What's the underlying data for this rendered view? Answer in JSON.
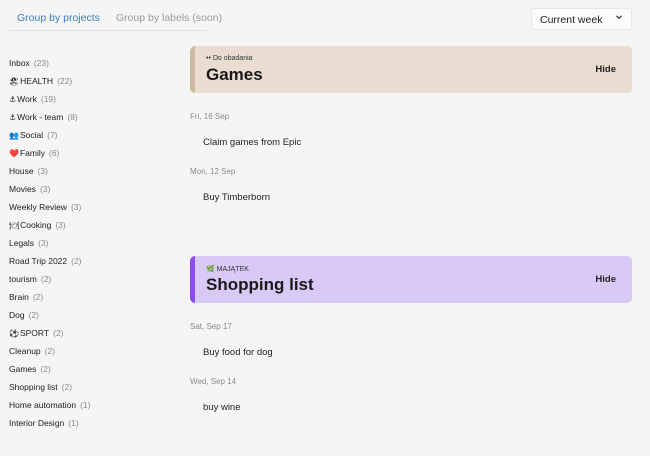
{
  "tabs": [
    {
      "label": "Group by projects",
      "active": true
    },
    {
      "label": "Group by labels (soon)",
      "active": false
    }
  ],
  "period_select": {
    "value": "Current week",
    "icon": "chevron-down-icon"
  },
  "projects": [
    {
      "emoji": "",
      "name": "Inbox",
      "count": "(23)"
    },
    {
      "emoji": "🏖",
      "name": "HEALTH",
      "count": "(22)"
    },
    {
      "emoji": "⚓",
      "name": "Work",
      "count": "(19)"
    },
    {
      "emoji": "⚓",
      "name": "Work - team",
      "count": "(8)"
    },
    {
      "emoji": "👥",
      "name": "Social",
      "count": "(7)"
    },
    {
      "emoji": "❤️",
      "name": "Family",
      "count": "(6)"
    },
    {
      "emoji": "",
      "name": "House",
      "count": "(3)"
    },
    {
      "emoji": "",
      "name": "Movies",
      "count": "(3)"
    },
    {
      "emoji": "",
      "name": "Weekly Review",
      "count": "(3)"
    },
    {
      "emoji": "🍽",
      "name": "Cooking",
      "count": "(3)"
    },
    {
      "emoji": "",
      "name": "Legals",
      "count": "(3)"
    },
    {
      "emoji": "",
      "name": "Road Trip 2022",
      "count": "(2)"
    },
    {
      "emoji": "",
      "name": "tourism",
      "count": "(2)"
    },
    {
      "emoji": "",
      "name": "Brain",
      "count": "(2)"
    },
    {
      "emoji": "",
      "name": "Dog",
      "count": "(2)"
    },
    {
      "emoji": "⚽",
      "name": "SPORT",
      "count": "(2)"
    },
    {
      "emoji": "",
      "name": "Cleanup",
      "count": "(2)"
    },
    {
      "emoji": "",
      "name": "Games",
      "count": "(2)"
    },
    {
      "emoji": "",
      "name": "Shopping list",
      "count": "(2)"
    },
    {
      "emoji": "",
      "name": "Home automation",
      "count": "(1)"
    },
    {
      "emoji": "",
      "name": "Interior Design",
      "count": "(1)"
    }
  ],
  "cards": {
    "games": {
      "subtitle": "•• Do obadania",
      "title": "Games",
      "hide_label": "Hide",
      "bg": "#e9ddd1",
      "border": "#cdb8a0",
      "tasks": [
        {
          "date": "Fri, 16 Sep",
          "text": "Claim games from Epic"
        },
        {
          "date": "Mon, 12 Sep",
          "text": "Buy Timberborn"
        }
      ]
    },
    "shopping": {
      "subtitle": "🌿 MAJĄTEK",
      "title": "Shopping list",
      "hide_label": "Hide",
      "bg": "#d9c9f7",
      "border": "#8a4cf0",
      "tasks": [
        {
          "date": "Sat, Sep 17",
          "text": "Buy food for dog"
        },
        {
          "date": "Wed, Sep 14",
          "text": "buy wine"
        }
      ]
    }
  }
}
